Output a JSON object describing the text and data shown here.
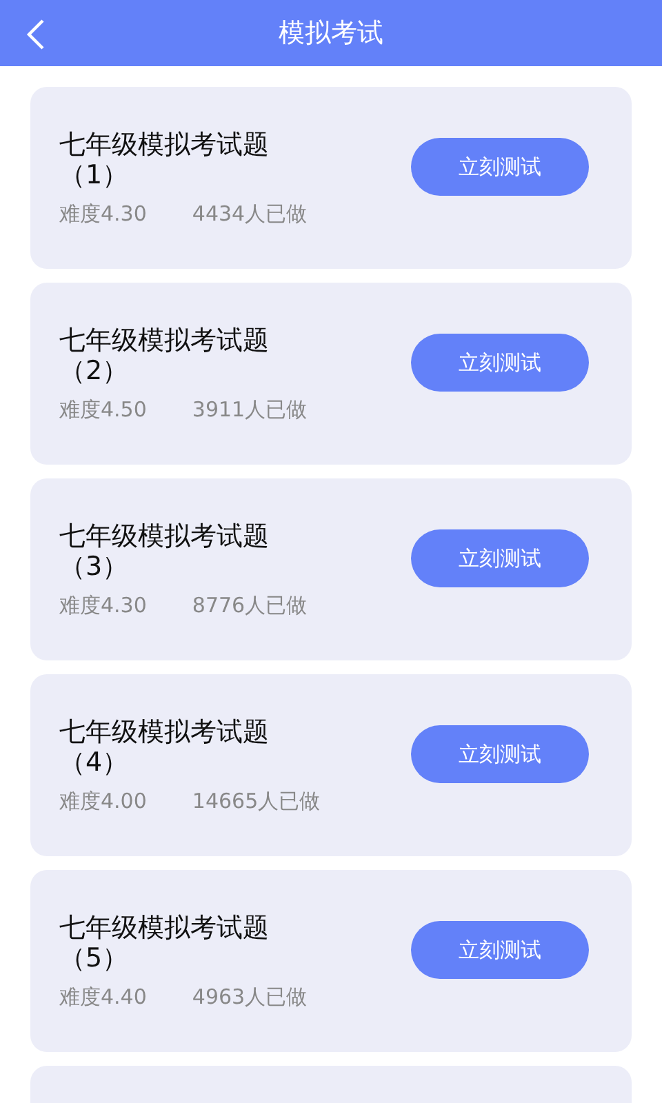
{
  "header": {
    "back_icon": true,
    "title": "模拟考试"
  },
  "exams": [
    {
      "title": "七年级模拟考试题（1）",
      "difficulty": "难度4.30",
      "count": "4434人已做",
      "button": "立刻测试"
    },
    {
      "title": "七年级模拟考试题（2）",
      "difficulty": "难度4.50",
      "count": "3911人已做",
      "button": "立刻测试"
    },
    {
      "title": "七年级模拟考试题（3）",
      "difficulty": "难度4.30",
      "count": "8776人已做",
      "button": "立刻测试"
    },
    {
      "title": "七年级模拟考试题（4）",
      "difficulty": "难度4.00",
      "count": "14665人已做",
      "button": "立刻测试"
    },
    {
      "title": "七年级模拟考试题（5）",
      "difficulty": "难度4.40",
      "count": "4963人已做",
      "button": "立刻测试"
    }
  ],
  "next_card_peeking": true
}
